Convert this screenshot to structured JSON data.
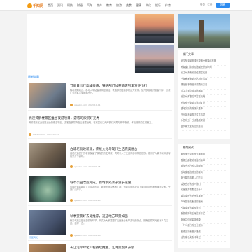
{
  "header": {
    "logo_text": "千知网",
    "nav": [
      "首页",
      "资讯",
      "科技",
      "财经",
      "汽车",
      "房产",
      "教育",
      "旅游",
      "美食",
      "健康",
      "文化",
      "娱乐",
      "体育"
    ],
    "user_text": "登录 | 注册",
    "button_label": "投稿"
  },
  "sidebar": {
    "card1": {
      "title": "热门文章",
      "items": [
        "武汉东湖绿道骑行攻略全程路线推荐",
        "黄鹤楼门票预约指南及开放时间",
        "长江大桥夜景最佳观赏位置",
        "户部巷美食街必吃小吃清单",
        "湖北省博物馆参观预约方法",
        "汉口江滩公园游玩路线",
        "武汉大学樱花季赏花攻略",
        "光谷步行街周末活动汇总",
        "楚河汉街购物娱乐推荐",
        "归元寺祈福游览注意事项",
        "木兰天池一日游路线规划",
        "昙华林文艺街区探店记"
      ]
    },
    "card2": {
      "title": "推荐阅读",
      "items": [
        "城市旅行中如何安排时间",
        "假期出游提前准备的清单",
        "带孩子出行的实用经验",
        "自驾游路线规划的技巧",
        "旅行摄影构图入门方法",
        "高铁出行省钱小窍门",
        "民宿选择需要注意什么",
        "周边游好去处盘点推荐",
        "户外露营装备选购指南",
        "古镇游玩的最佳季节",
        "夜游城市的正确打开方式",
        "旅途中如何保持健康",
        "一个人旅行的安全提示",
        "老城区街巷漫步路线",
        "地方特色美食寻味记"
      ]
    }
  },
  "feed": {
    "heading": "最新文章",
    "articles": [
      {
        "title": "节假日出行高峰来临，铁路部门加开旅客列车方便出行",
        "excerpt": "随着假期临近，各地火车站客流明显增加，铁路部门提前部署运力安排，加开多趟临时旅客列车，方便广大旅客平安顺利出行。",
        "author": "qianzhi.com",
        "date": "2023-10-01"
      },
      {
        "title": "武汉黄鹤楼景区推出夜游项目，游客可欣赏灯光秀",
        "excerpt": "黄鹤楼景区近日推出全新夜游项目，游客在夜幕降临后登楼远眺，可欣赏长江两岸的灯光秀与城市夜景，体验别样的江城魅力。",
        "author": "qianzhi.com",
        "date": "2023-09-28"
      },
      {
        "title": "古城老街焕新颜，传统文化与现代生活完美融合",
        "excerpt": "经过改造提升的老街保留了原有的历史风貌，同时引入了文创商店和特色餐饮，吸引了大量市民和游客前来打卡游玩。",
        "author": "qianzhi.com",
        "date": "2023-09-25"
      },
      {
        "title": "城市公园改造完成，新增多处亲子游乐设施",
        "excerpt": "公园改造后新增了儿童游乐区、健身步道和休闲广场，为周边居民提供了更加丰富的休闲娱乐空间，受到广泛好评。",
        "author": "qianzhi.com",
        "date": "2023-09-20"
      },
      {
        "title": "秋季赏景好去处推荐，这些地方风景如画",
        "excerpt": "秋高气爽正是出游的好时节，本文为大家整理了几处适合秋季游玩的景点，既有自然风光也有人文古迹，值得一去。",
        "author": "qianzhi.com",
        "date": "2023-09-18",
        "gallery_caption": "景区风光"
      },
      {
        "title": "长江沿岸绿化工程持续推进，江滩景观再升级",
        "author": "qianzhi.com",
        "date": "2023-09-15"
      }
    ]
  },
  "colors": {
    "accent": "#2d8cf0",
    "logo": "#e67e22"
  }
}
